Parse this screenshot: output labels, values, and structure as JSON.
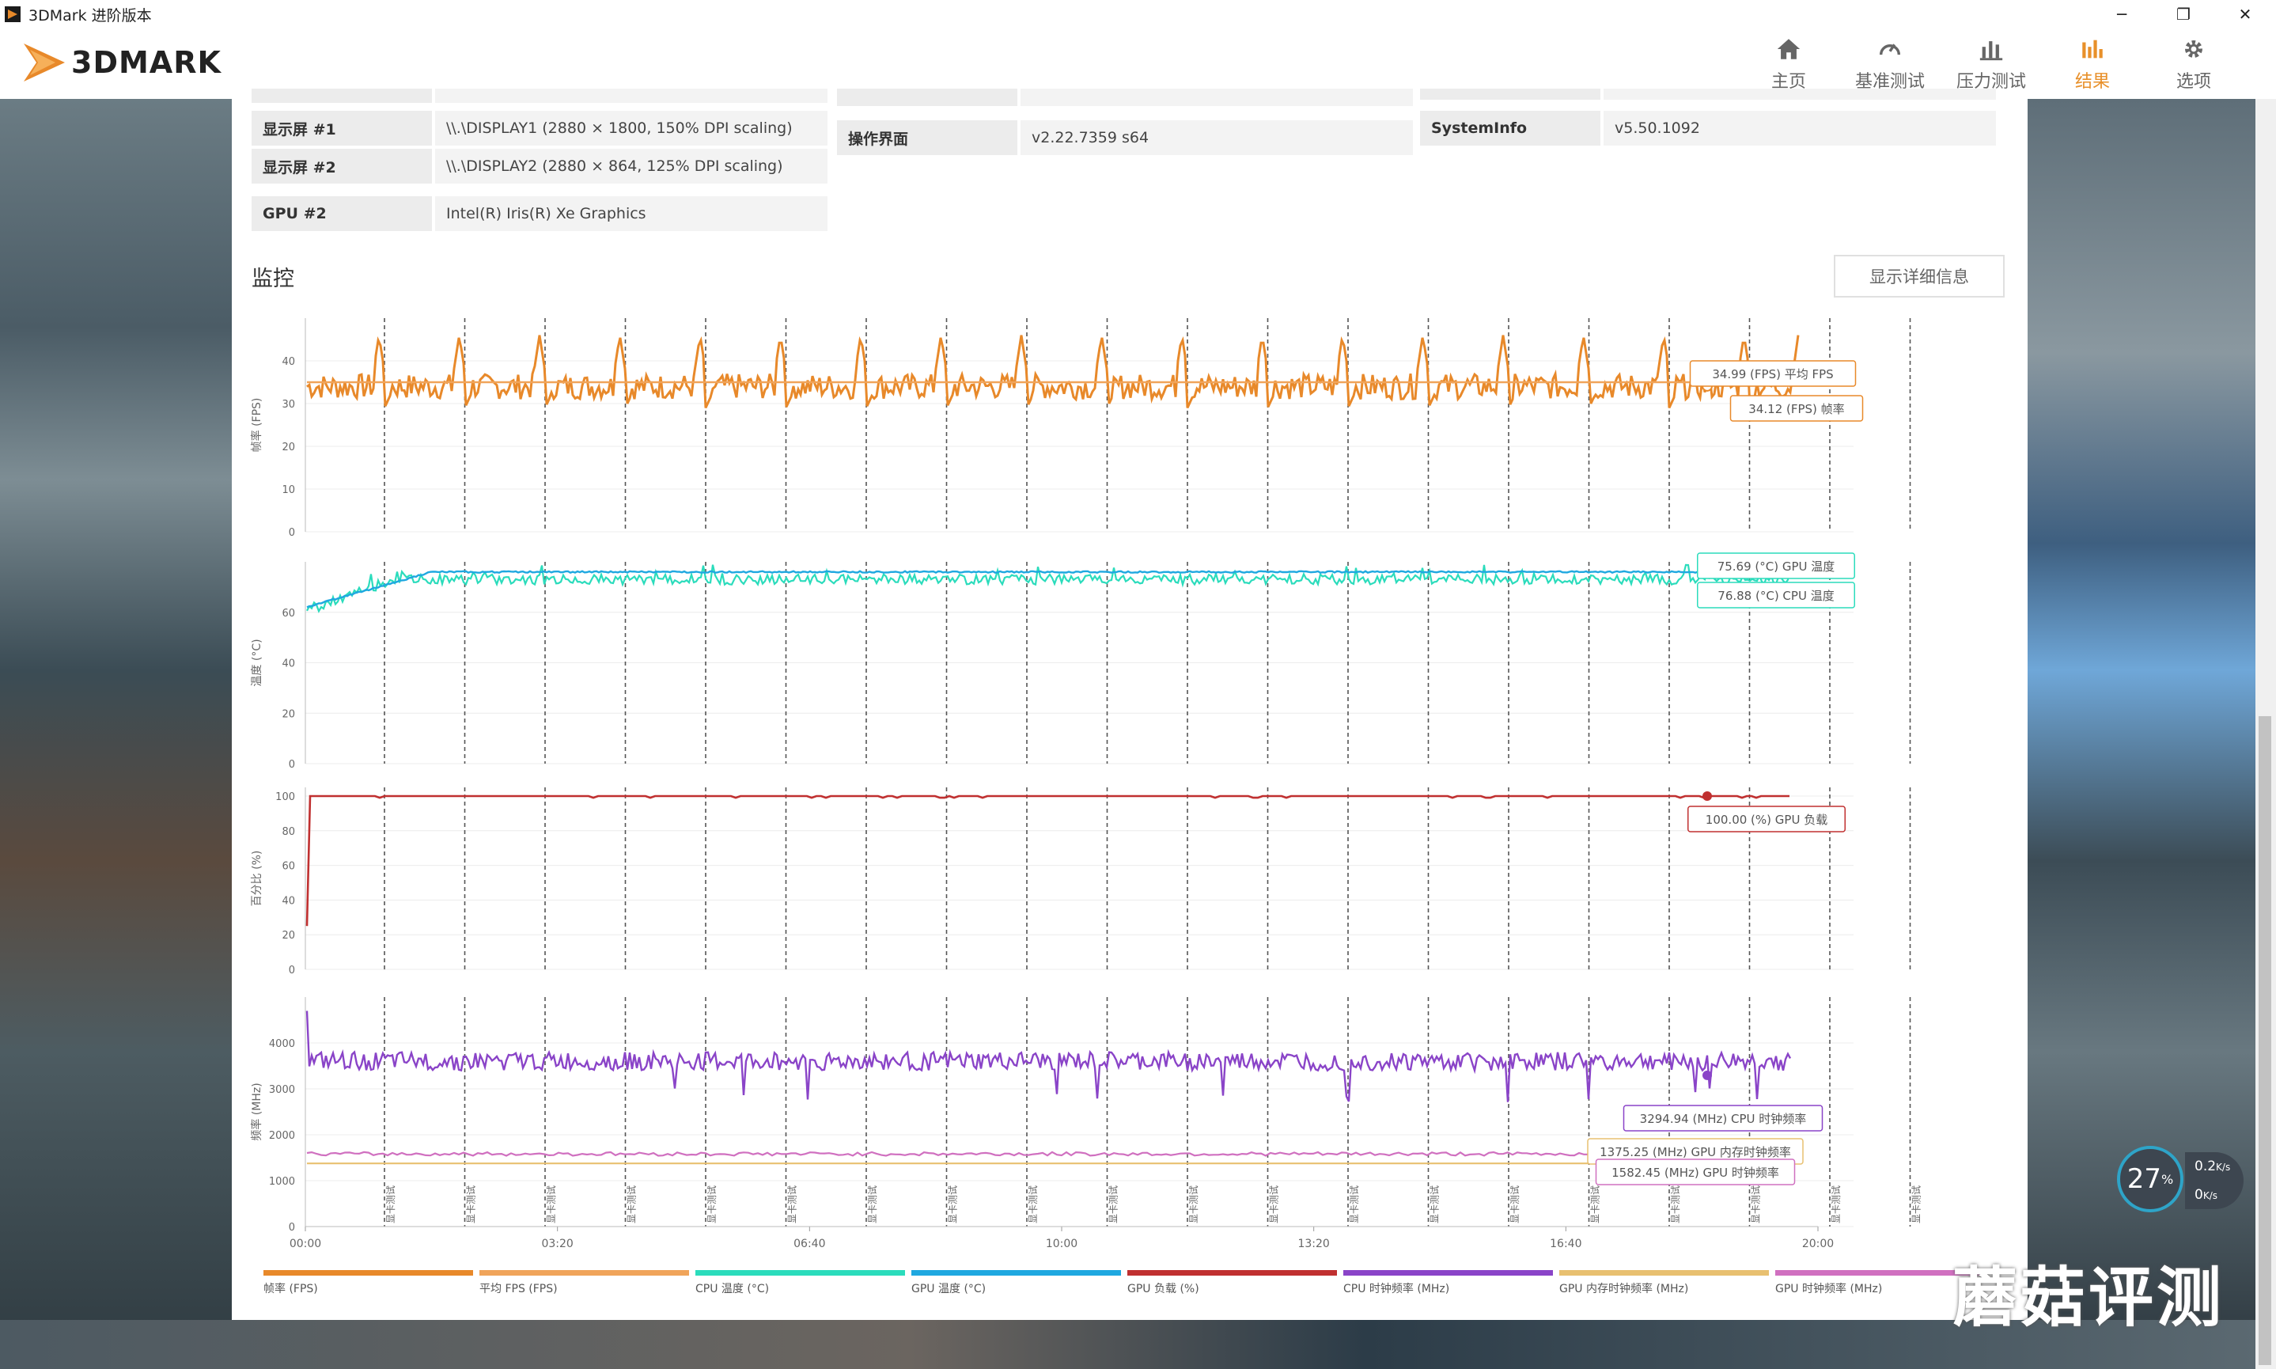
{
  "window": {
    "title": "3DMark 进阶版本",
    "controls": [
      "─",
      "❐",
      "✕"
    ]
  },
  "app": {
    "brand": "3DMARK"
  },
  "nav": [
    {
      "label": "主页",
      "icon": "home-icon",
      "active": false
    },
    {
      "label": "基准测试",
      "icon": "gauge-icon",
      "active": false
    },
    {
      "label": "压力测试",
      "icon": "bars-icon",
      "active": false
    },
    {
      "label": "结果",
      "icon": "chart-icon",
      "active": true
    },
    {
      "label": "选项",
      "icon": "gear-icon",
      "active": false
    }
  ],
  "info": {
    "display1": {
      "key": "显示屏 #1",
      "value": "\\\\.\\DISPLAY1 (2880 × 1800, 150% DPI scaling)"
    },
    "display2": {
      "key": "显示屏 #2",
      "value": "\\\\.\\DISPLAY2 (2880 × 864, 125% DPI scaling)"
    },
    "gpu2": {
      "key": "GPU #2",
      "value": "Intel(R) Iris(R) Xe Graphics"
    },
    "ui": {
      "key": "操作界面",
      "value": "v2.22.7359 s64"
    },
    "sysinfo": {
      "key": "SystemInfo",
      "value": "v5.50.1092"
    }
  },
  "monitor": {
    "title": "监控",
    "details_button": "显示详细信息"
  },
  "chart_data": {
    "type": "line",
    "x_ticks": [
      "00:00",
      "03:20",
      "06:40",
      "10:00",
      "13:20",
      "16:40",
      "20:00"
    ],
    "x_range_seconds": [
      0,
      1200
    ],
    "loop_marker_label": "显卡测试",
    "loop_count": 20,
    "panels": [
      {
        "ylabel": "帧率 (FPS)",
        "ylim": [
          0,
          50
        ],
        "yticks": [
          0,
          10,
          20,
          30,
          40
        ],
        "series": [
          {
            "name": "帧率 (FPS)",
            "color": "#e8892a",
            "typical": 34,
            "peak": 46,
            "dip": 29
          },
          {
            "name": "平均 FPS (FPS)",
            "color": "#f0a45a",
            "value": 34.99
          }
        ],
        "annotations": [
          "34.99 (FPS) 平均 FPS",
          "34.12 (FPS) 帧率"
        ]
      },
      {
        "ylabel": "温度 (°C)",
        "ylim": [
          0,
          80
        ],
        "yticks": [
          0,
          20,
          40,
          60
        ],
        "series": [
          {
            "name": "CPU 温度 (°C)",
            "color": "#2bdcbc",
            "start": 60,
            "plateau": 73
          },
          {
            "name": "GPU 温度 (°C)",
            "color": "#1fa8e0",
            "start": 62,
            "plateau": 76
          }
        ],
        "annotations": [
          "75.69 (°C) GPU 温度",
          "76.88 (°C) CPU 温度"
        ]
      },
      {
        "ylabel": "百分比 (%)",
        "ylim": [
          0,
          105
        ],
        "yticks": [
          0,
          20,
          40,
          60,
          80,
          100
        ],
        "series": [
          {
            "name": "GPU 负载 (%)",
            "color": "#c03030",
            "value": 100
          }
        ],
        "annotations": [
          "100.00 (%) GPU 负载"
        ]
      },
      {
        "ylabel": "频率 (MHz)",
        "ylim": [
          0,
          5000
        ],
        "yticks": [
          0,
          1000,
          2000,
          3000,
          4000
        ],
        "series": [
          {
            "name": "CPU 时钟频率 (MHz)",
            "color": "#8a44c8",
            "typical": 3600
          },
          {
            "name": "GPU 内存时钟频率 (MHz)",
            "color": "#e8c070",
            "value": 1375.25
          },
          {
            "name": "GPU 时钟频率 (MHz)",
            "color": "#d070c0",
            "value": 1582.45
          }
        ],
        "annotations": [
          "3294.94 (MHz) CPU 时钟频率",
          "1375.25 (MHz) GPU 内存时钟频率",
          "1582.45 (MHz) GPU 时钟频率"
        ]
      }
    ],
    "legend": [
      {
        "name": "帧率 (FPS)",
        "color": "#e8892a"
      },
      {
        "name": "平均 FPS (FPS)",
        "color": "#f0a45a"
      },
      {
        "name": "CPU 温度 (°C)",
        "color": "#2bdcbc"
      },
      {
        "name": "GPU 温度 (°C)",
        "color": "#1fa8e0"
      },
      {
        "name": "GPU 负载 (%)",
        "color": "#c03030"
      },
      {
        "name": "CPU 时钟频率 (MHz)",
        "color": "#8a44c8"
      },
      {
        "name": "GPU 内存时钟频率 (MHz)",
        "color": "#e8c070"
      },
      {
        "name": "GPU 时钟频率 (MHz)",
        "color": "#d070c0"
      }
    ]
  },
  "overlay": {
    "watermark": "蘑菇评测",
    "hud_percent": "27",
    "hud_percent_unit": "%",
    "hud_up": "0.2",
    "hud_down": "0",
    "hud_unit": "K/s"
  }
}
